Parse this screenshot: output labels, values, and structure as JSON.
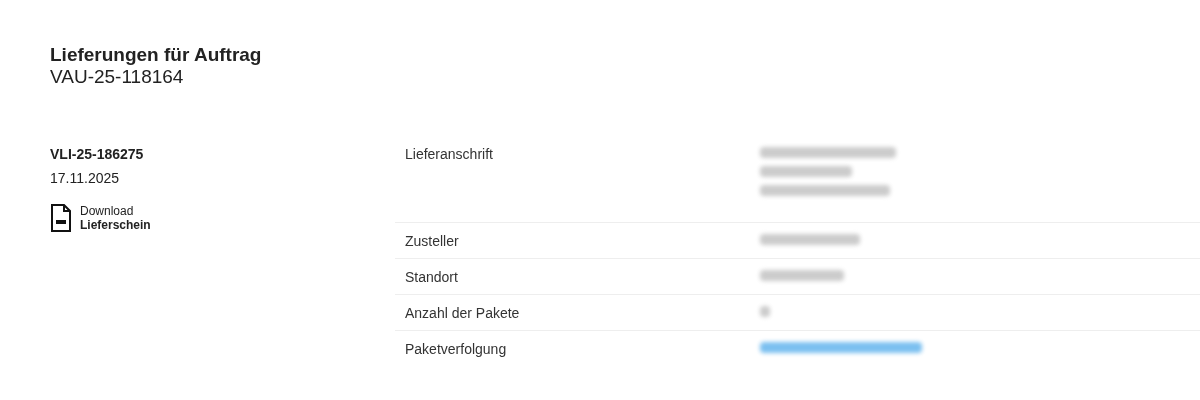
{
  "page": {
    "title": "Lieferungen für Auftrag",
    "order_number": "VAU-25-118164"
  },
  "delivery": {
    "number": "VLI-25-186275",
    "date": "17.11.2025",
    "download": {
      "label": "Download",
      "document": "Lieferschein"
    }
  },
  "details": [
    {
      "label": "Lieferanschrift",
      "value_lines": [
        {
          "kind": "blurred"
        },
        {
          "kind": "blurred"
        },
        {
          "kind": "blurred"
        }
      ]
    },
    {
      "label": "Zusteller",
      "value_lines": [
        {
          "kind": "blurred"
        }
      ]
    },
    {
      "label": "Standort",
      "value_lines": [
        {
          "kind": "blurred"
        }
      ]
    },
    {
      "label": "Anzahl der Pakete",
      "value_lines": [
        {
          "kind": "blurred"
        }
      ]
    },
    {
      "label": "Paketverfolgung",
      "value_lines": [
        {
          "kind": "blurred-link"
        }
      ]
    }
  ]
}
